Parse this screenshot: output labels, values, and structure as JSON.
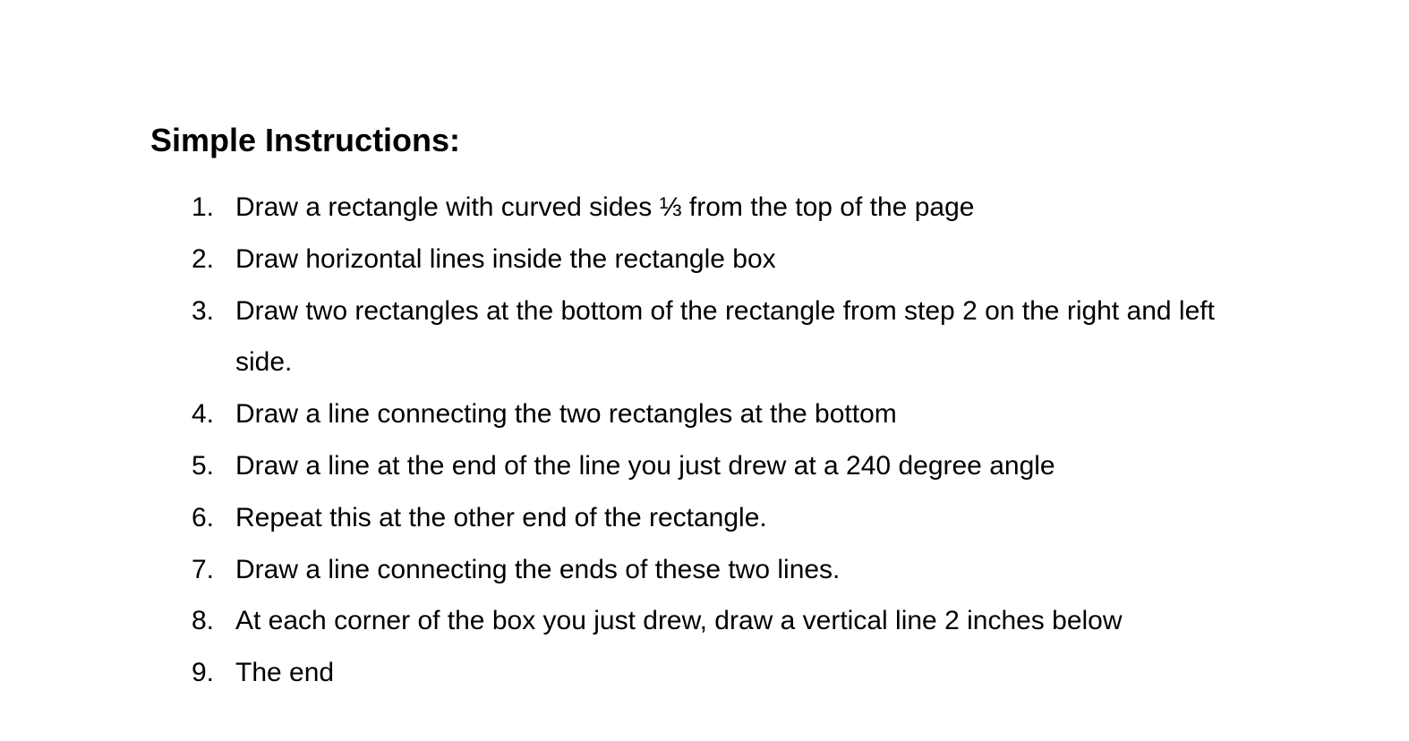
{
  "document": {
    "heading": "Simple Instructions:",
    "steps": [
      {
        "number": "1.",
        "text": "Draw a rectangle with curved sides ⅓ from the top of the page"
      },
      {
        "number": "2.",
        "text": "Draw horizontal lines inside the rectangle box"
      },
      {
        "number": "3.",
        "text": "Draw two rectangles at the bottom of the rectangle from step 2 on the right and left side."
      },
      {
        "number": "4.",
        "text": "Draw a line connecting the two rectangles at the bottom"
      },
      {
        "number": "5.",
        "text": "Draw a line at the end of the line you just drew at a 240 degree angle"
      },
      {
        "number": "6.",
        "text": "Repeat this at the other end of the rectangle."
      },
      {
        "number": "7.",
        "text": "Draw a line connecting the ends of these two lines."
      },
      {
        "number": "8.",
        "text": "At each corner of the box you just drew, draw a vertical line 2 inches below"
      },
      {
        "number": "9.",
        "text": "The end"
      }
    ]
  }
}
